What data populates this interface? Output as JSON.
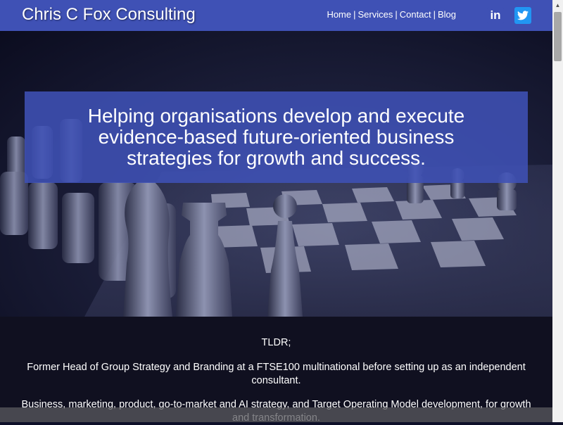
{
  "header": {
    "title": "Chris C Fox Consulting",
    "nav": [
      {
        "label": "Home"
      },
      {
        "label": "Services"
      },
      {
        "label": "Contact"
      },
      {
        "label": "Blog"
      }
    ],
    "separator": "|",
    "social": [
      {
        "name": "linkedin-icon",
        "glyph": "in",
        "color": "#3f51b5"
      },
      {
        "name": "twitter-icon",
        "color": "#2196f3"
      }
    ]
  },
  "hero": {
    "tagline": "Helping organisations develop and execute evidence-based future-oriented business strategies for growth and success."
  },
  "content": {
    "paragraphs": [
      "TLDR;",
      "Former Head of Group Strategy and Branding at a FTSE100 multinational before setting up as an independent consultant.",
      "Business, marketing, product, go-to-market and AI strategy, and Target Operating Model development, for growth and transformation."
    ]
  },
  "colors": {
    "accent": "#3f51b5",
    "twitter": "#2196f3"
  }
}
